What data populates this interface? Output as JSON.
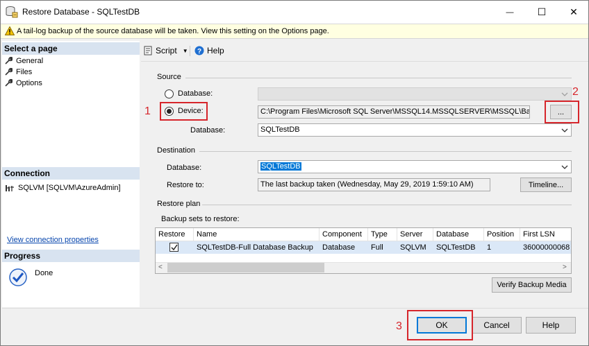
{
  "window": {
    "title": "Restore Database - SQLTestDB",
    "minimize_glyph": "—",
    "maximize_glyph": "☐",
    "close_glyph": "✕"
  },
  "warning": {
    "icon": "warning-icon",
    "text": "A tail-log backup of the source database will be taken. View this setting on the Options page."
  },
  "sidebar": {
    "select_page_header": "Select a page",
    "pages": [
      {
        "label": "General",
        "icon": "wrench-icon"
      },
      {
        "label": "Files",
        "icon": "wrench-icon"
      },
      {
        "label": "Options",
        "icon": "wrench-icon"
      }
    ],
    "connection_header": "Connection",
    "connection_server": "SQLVM [SQLVM\\AzureAdmin]",
    "view_connection_link": "View connection properties",
    "progress_header": "Progress",
    "progress_status": "Done"
  },
  "toolbar": {
    "script_label": "Script",
    "help_label": "Help"
  },
  "source": {
    "group_label": "Source",
    "database_radio_label": "Database:",
    "database_value": "",
    "device_radio_label": "Device:",
    "device_path": "C:\\Program Files\\Microsoft SQL Server\\MSSQL14.MSSQLSERVER\\MSSQL\\Bac",
    "browse_label": "...",
    "source_db_label": "Database:",
    "source_db_value": "SQLTestDB"
  },
  "destination": {
    "group_label": "Destination",
    "database_label": "Database:",
    "database_value": "SQLTestDB",
    "restore_to_label": "Restore to:",
    "restore_to_value": "The last backup taken (Wednesday, May 29, 2019 1:59:10 AM)",
    "timeline_label": "Timeline..."
  },
  "restore_plan": {
    "group_label": "Restore plan",
    "backup_sets_label": "Backup sets to restore:",
    "columns": [
      "Restore",
      "Name",
      "Component",
      "Type",
      "Server",
      "Database",
      "Position",
      "First LSN"
    ],
    "rows": [
      {
        "restore_checked": true,
        "name": "SQLTestDB-Full Database Backup",
        "component": "Database",
        "type": "Full",
        "server": "SQLVM",
        "database": "SQLTestDB",
        "position": "1",
        "first_lsn": "36000000068"
      }
    ],
    "scroll_left_glyph": "<",
    "scroll_right_glyph": ">",
    "verify_label": "Verify Backup Media"
  },
  "footer": {
    "ok_label": "OK",
    "cancel_label": "Cancel",
    "help_label": "Help"
  },
  "annotations": {
    "step1": "1",
    "step2": "2",
    "step3": "3"
  },
  "colors": {
    "annotation_red": "#d6252b",
    "selection_blue": "#0078d7",
    "section_header": "#d8e3f0",
    "warning_bg": "#ffffe1",
    "link_blue": "#0645ad"
  }
}
